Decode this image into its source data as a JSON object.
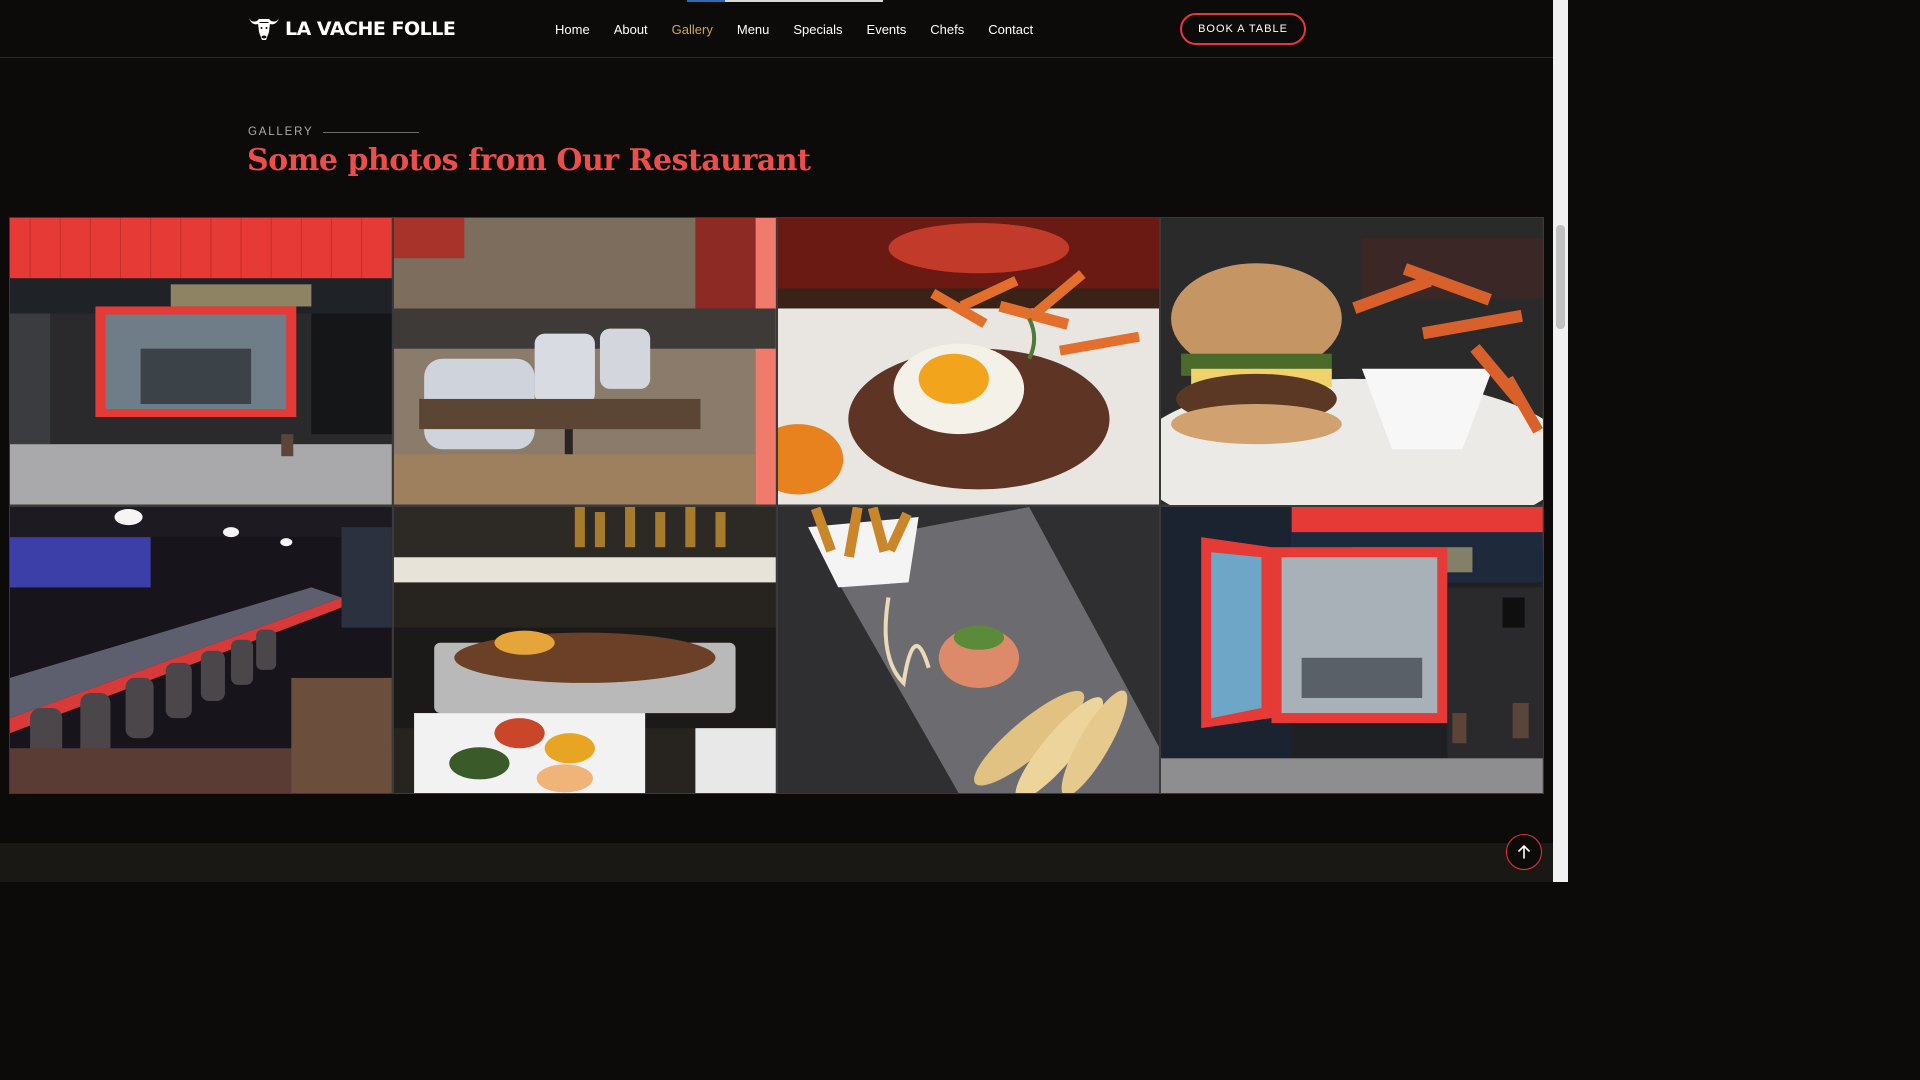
{
  "header": {
    "logo_text": "LA VACHE FOLLE",
    "nav": [
      {
        "label": "Home"
      },
      {
        "label": "About"
      },
      {
        "label": "Gallery",
        "active": true
      },
      {
        "label": "Menu"
      },
      {
        "label": "Specials"
      },
      {
        "label": "Events"
      },
      {
        "label": "Chefs"
      },
      {
        "label": "Contact"
      }
    ],
    "book_button": "BOOK A TABLE"
  },
  "gallery_section": {
    "label": "GALLERY",
    "title": "Some photos from Our Restaurant",
    "photos": [
      {
        "subject": "storefront-front"
      },
      {
        "subject": "dining-room-tables"
      },
      {
        "subject": "steak-and-egg-dish"
      },
      {
        "subject": "burger-with-sweet-potato-fries"
      },
      {
        "subject": "bar-counter"
      },
      {
        "subject": "grill-platter-with-sauces"
      },
      {
        "subject": "tartare-with-fries-and-bread"
      },
      {
        "subject": "storefront-side"
      }
    ]
  },
  "colors": {
    "accent_red": "#e8363d",
    "title_red": "#ec4e4a",
    "active_gold": "#cda45e",
    "background": "#0c0b09"
  },
  "icons": {
    "logo": "bull-head-icon",
    "scroll_top": "arrow-up-icon"
  }
}
